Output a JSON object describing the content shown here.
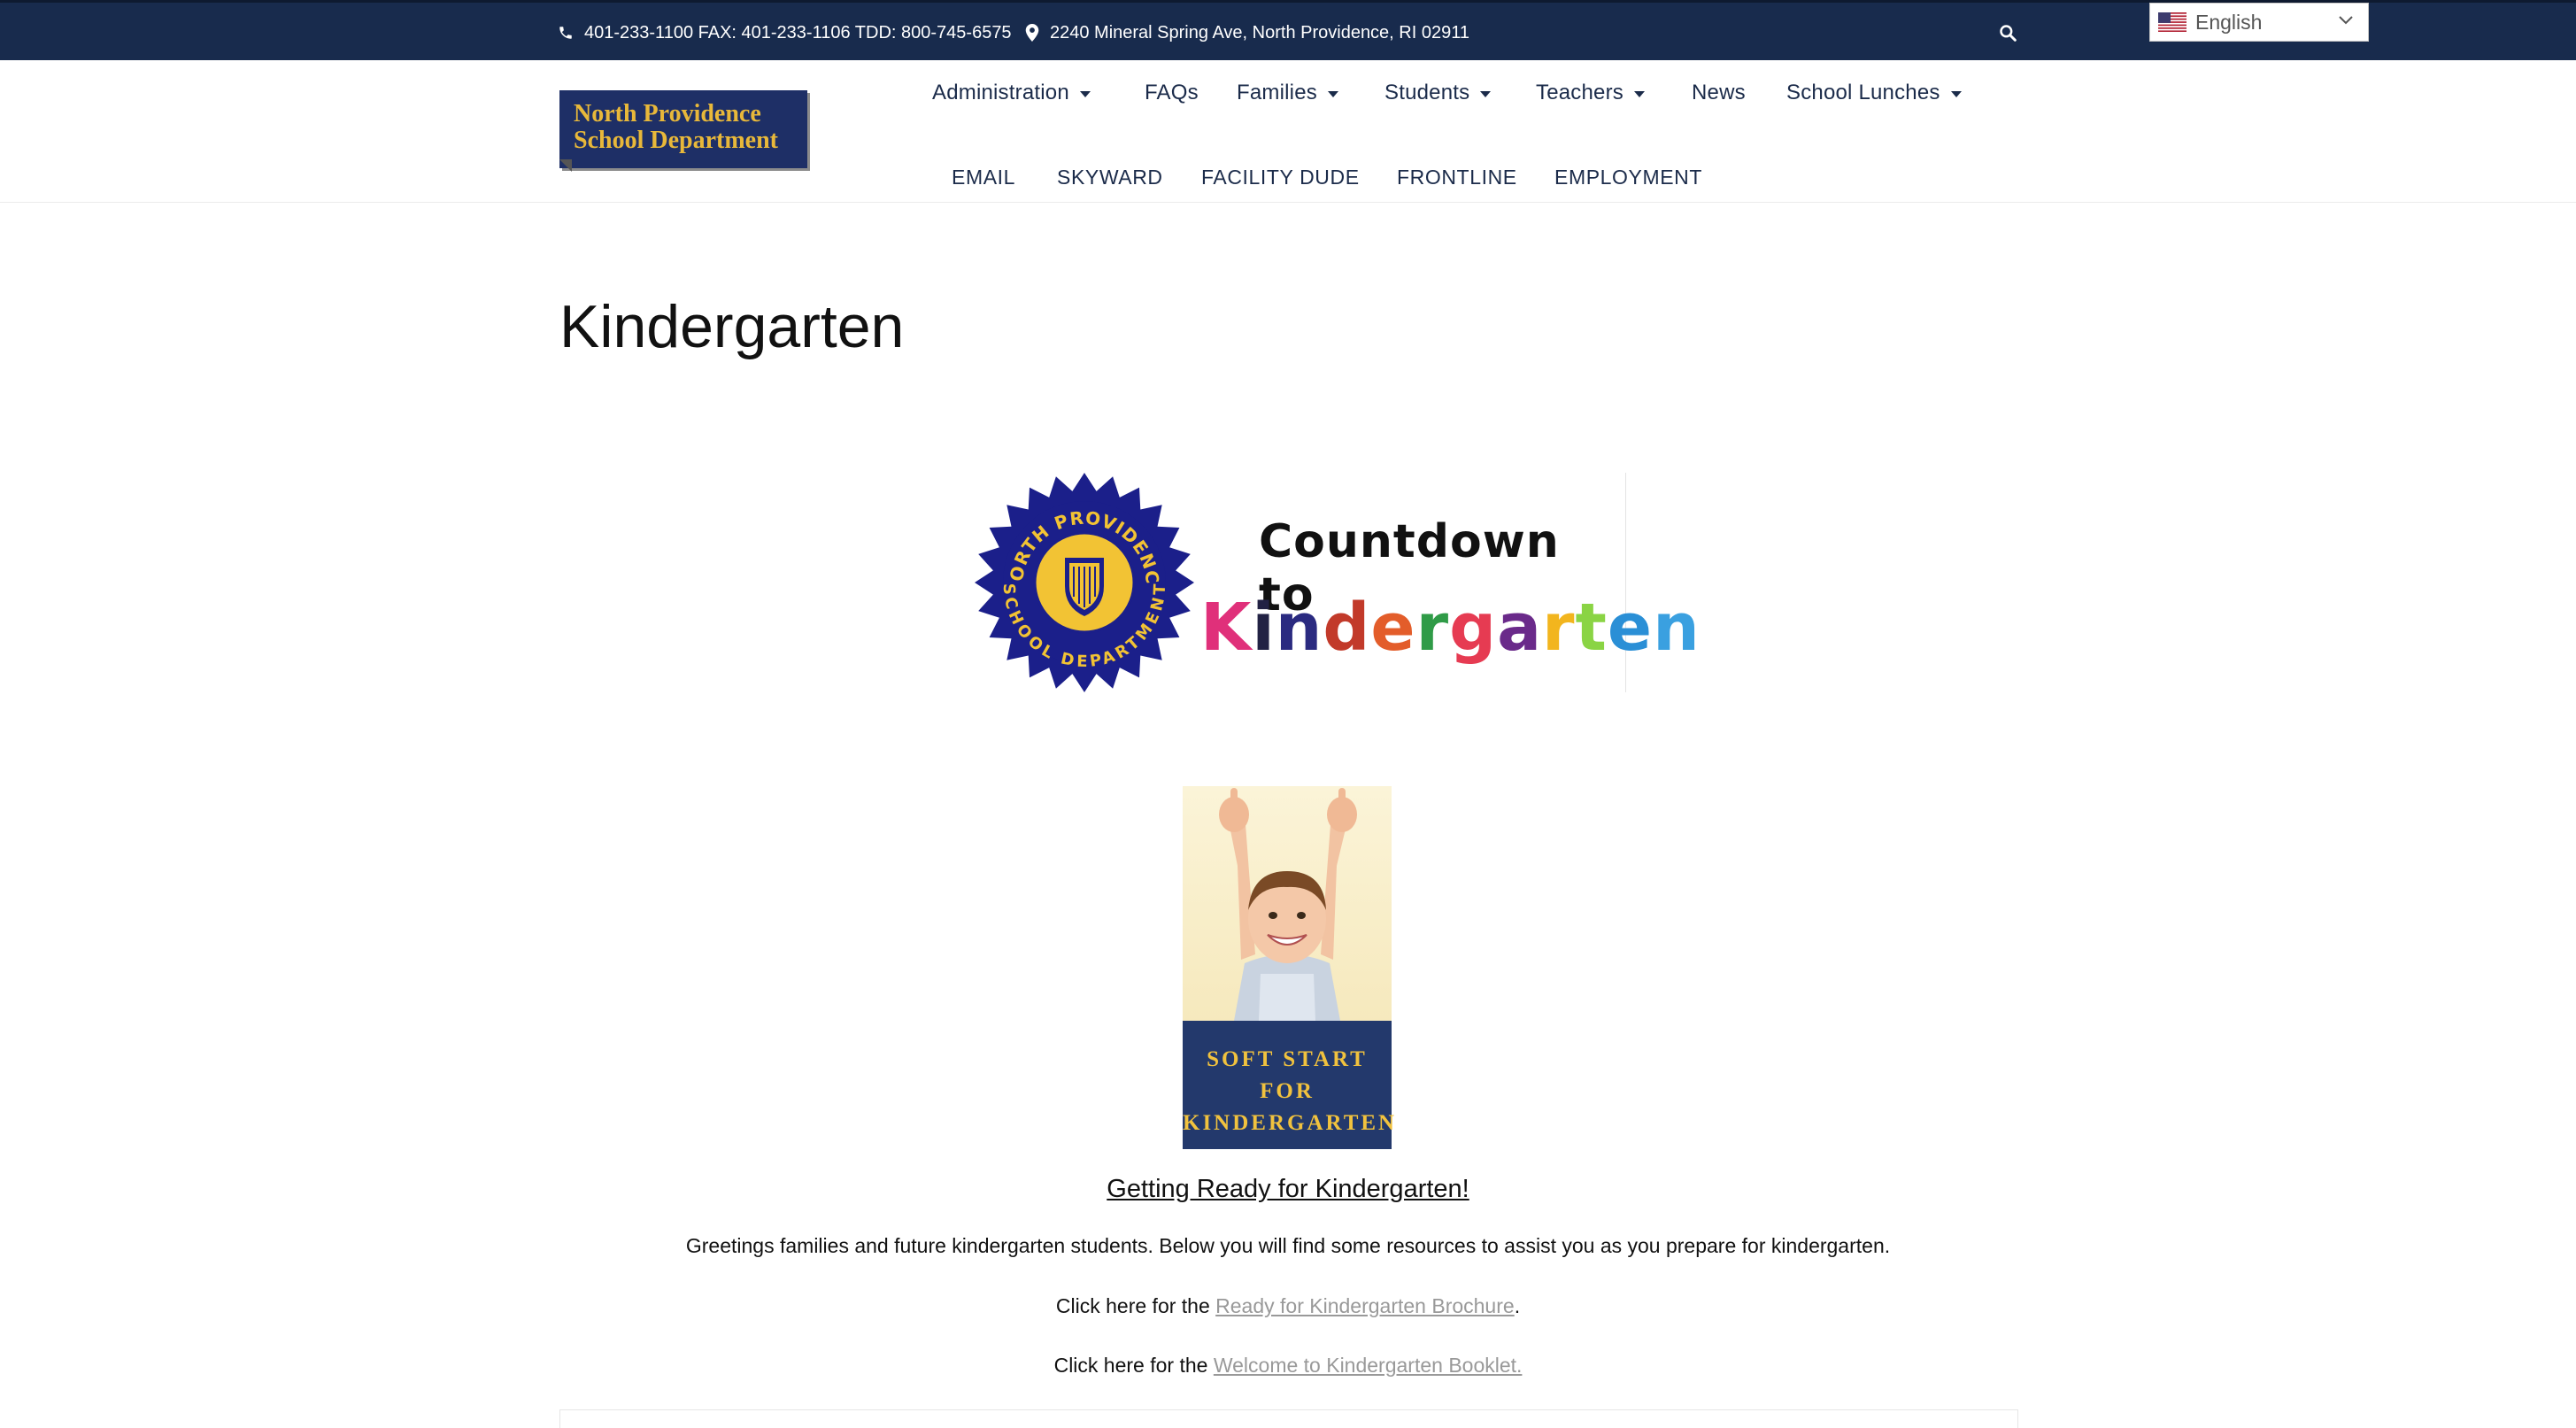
{
  "topbar": {
    "contact": "401-233-1100 FAX: 401-233-1106 TDD: 800-745-6575",
    "address": "2240 Mineral Spring Ave, North Providence, RI 02911",
    "language": "English"
  },
  "logo": {
    "line1": "North Providence",
    "line2": "School Department"
  },
  "nav": {
    "primary": [
      {
        "label": "Administration",
        "dropdown": true
      },
      {
        "label": "FAQs",
        "dropdown": false
      },
      {
        "label": "Families",
        "dropdown": true
      },
      {
        "label": "Students",
        "dropdown": true
      },
      {
        "label": "Teachers",
        "dropdown": true
      },
      {
        "label": "News",
        "dropdown": false
      },
      {
        "label": "School Lunches",
        "dropdown": true
      }
    ],
    "secondary": [
      "EMAIL",
      "SKYWARD",
      "FACILITY DUDE",
      "FRONTLINE",
      "EMPLOYMENT"
    ]
  },
  "page": {
    "title": "Kindergarten"
  },
  "banner": {
    "seal_top": "NORTH PROVIDENCE",
    "seal_bottom": "SCHOOL DEPARTMENT",
    "heading": "Countdown to",
    "word": "Kindergarten",
    "letter_colors": [
      "#e0307a",
      "#222244",
      "#2a2a80",
      "#c23a2a",
      "#e35d2a",
      "#2f9b47",
      "#e63b52",
      "#6a2a8a",
      "#f2b51e",
      "#8ad444",
      "#2a8fd6",
      "#3aa0e0"
    ]
  },
  "soft_start": {
    "line1": "SOFT START",
    "line2": "FOR",
    "line3": "KINDERGARTEN"
  },
  "content": {
    "subheading": "Getting Ready for Kindergarten!",
    "intro": "Greetings families and future kindergarten students.  Below you will find some resources to assist you as you prepare for kindergarten.",
    "brochure_prefix": "Click here for the ",
    "brochure_link": "Ready for Kindergarten Brochure",
    "brochure_suffix": ".",
    "booklet_prefix": "Click here for the ",
    "booklet_link": "Welcome to Kindergarten Booklet."
  },
  "colors": {
    "topbar": "#182b4d",
    "nav_text": "#1b2b4a",
    "logo_bg": "#1e2f66",
    "logo_text": "#e8b83a",
    "seal_blue": "#1b1f8a",
    "seal_gold": "#f2c334",
    "soft_band": "#23396c",
    "soft_text": "#f1c23e"
  },
  "icons": [
    "phone-icon",
    "map-pin-icon",
    "search-icon",
    "us-flag-icon",
    "chevron-down-icon"
  ]
}
